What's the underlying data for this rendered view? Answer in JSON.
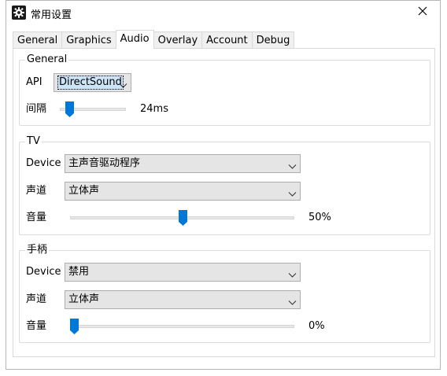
{
  "window": {
    "title": "常用设置",
    "icon": "gear-icon",
    "close_icon": "close-icon"
  },
  "tabs": [
    {
      "label": "General",
      "active": false
    },
    {
      "label": "Graphics",
      "active": false
    },
    {
      "label": "Audio",
      "active": true
    },
    {
      "label": "Overlay",
      "active": false
    },
    {
      "label": "Account",
      "active": false
    },
    {
      "label": "Debug",
      "active": false
    }
  ],
  "general": {
    "title": "General",
    "api_label": "API",
    "api_value": "DirectSound",
    "interval_label": "间隔",
    "interval_value": "24ms",
    "interval_level": 0.1
  },
  "tv": {
    "title": "TV",
    "device_label": "Device",
    "device_value": "主声音驱动程序",
    "channel_label": "声道",
    "channel_value": "立体声",
    "volume_label": "音量",
    "volume_value": "50%",
    "volume_level": 0.5
  },
  "controller": {
    "title": "手柄",
    "device_label": "Device",
    "device_value": "禁用",
    "channel_label": "声道",
    "channel_value": "立体声",
    "volume_label": "音量",
    "volume_value": "0%",
    "volume_level": 0.0
  },
  "colors": {
    "accent": "#0078d7",
    "dropdown_bg": "#e5e5e5",
    "border": "#adadad"
  }
}
